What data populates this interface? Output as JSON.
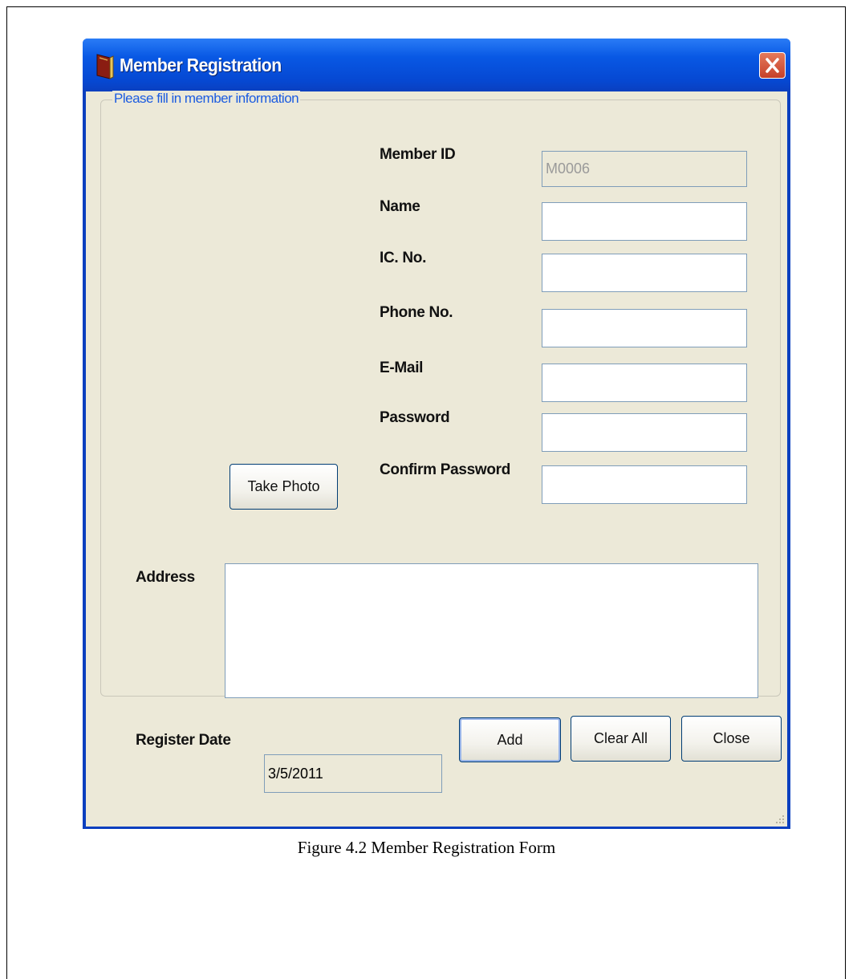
{
  "window": {
    "title": "Member Registration"
  },
  "group": {
    "legend": "Please fill in member information"
  },
  "fields": {
    "member_id": {
      "label": "Member ID",
      "value": "M0006"
    },
    "name": {
      "label": "Name",
      "value": ""
    },
    "ic_no": {
      "label": "IC. No.",
      "value": ""
    },
    "phone_no": {
      "label": "Phone No.",
      "value": ""
    },
    "email": {
      "label": "E-Mail",
      "value": ""
    },
    "password": {
      "label": "Password",
      "value": ""
    },
    "confirm_password": {
      "label": "Confirm Password",
      "value": ""
    },
    "address": {
      "label": "Address",
      "value": ""
    },
    "register_date": {
      "label": "Register Date",
      "value": "3/5/2011"
    }
  },
  "buttons": {
    "take_photo": "Take Photo",
    "add": "Add",
    "clear_all": "Clear All",
    "close": "Close"
  },
  "icons": {
    "app": "book-icon",
    "close": "close-icon"
  },
  "caption": "Figure 4.2 Member Registration Form"
}
